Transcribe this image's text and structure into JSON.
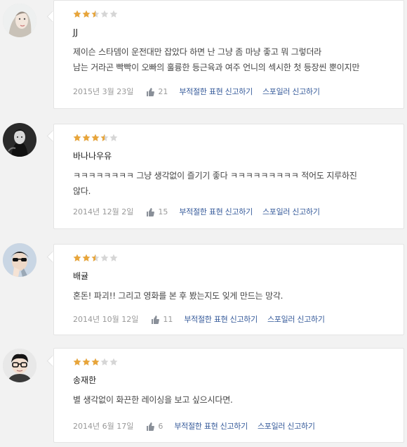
{
  "colors": {
    "star_on": "#e8a53a",
    "star_off": "#d6d6d6",
    "link": "#355a9a",
    "meta": "#999999"
  },
  "reviews": [
    {
      "avatar": "woman-portrait-icon",
      "rating": 2.5,
      "name": "JJ",
      "text_lines": [
        "제이슨 스타뎀이 운전대만 잡았다 하면 난 그냥 좀 마냥 좋고 뭐 그렇더라",
        "남는 거라곤 빡빡이 오빠의 훌륭한 등근육과 여주 언니의 섹시한 첫 등장씬 뿐이지만"
      ],
      "date": "2015년 3월 23일",
      "likes": "21",
      "report_label": "부적절한 표현 신고하기",
      "spoiler_label": "스포일러 신고하기"
    },
    {
      "avatar": "man-portrait-icon",
      "rating": 3.5,
      "name": "바나나우유",
      "text_lines": [
        "ㅋㅋㅋㅋㅋㅋㅋㅋ 그냥 생각없이 즐기기 좋다 ㅋㅋㅋㅋㅋㅋㅋㅋㅋ 적어도 지루하진",
        "않다."
      ],
      "date": "2014년 12월 2일",
      "likes": "15",
      "report_label": "부적절한 표현 신고하기",
      "spoiler_label": "스포일러 신고하기"
    },
    {
      "avatar": "sunglasses-person-icon",
      "rating": 2.5,
      "name": "배귤",
      "text_lines": [
        "혼돈! 파괴!! 그리고 영화를 본 후 봤는지도 잊게 만드는 망각."
      ],
      "date": "2014년 10월 12일",
      "likes": "11",
      "report_label": "부적절한 표현 신고하기",
      "spoiler_label": "스포일러 신고하기"
    },
    {
      "avatar": "glasses-person-icon",
      "rating": 3,
      "name": "송재한",
      "text_lines": [
        "별 생각없이 화끈한 레이싱을 보고 싶으시다면."
      ],
      "date": "2014년 6월 17일",
      "likes": "6",
      "report_label": "부적절한 표현 신고하기",
      "spoiler_label": "스포일러 신고하기"
    }
  ]
}
